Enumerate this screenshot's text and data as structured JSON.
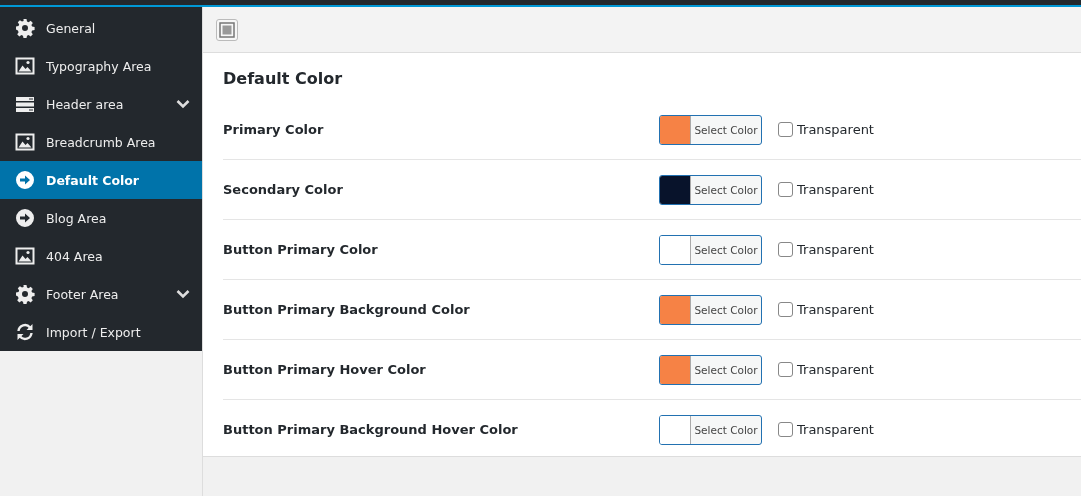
{
  "sidebar": {
    "items": [
      {
        "label": "General",
        "kind": "gear",
        "selected": false,
        "has_submenu": false
      },
      {
        "label": "Typography Area",
        "kind": "image",
        "selected": false,
        "has_submenu": false
      },
      {
        "label": "Header area",
        "kind": "list",
        "selected": false,
        "has_submenu": true
      },
      {
        "label": "Breadcrumb Area",
        "kind": "image",
        "selected": false,
        "has_submenu": false
      },
      {
        "label": "Default Color",
        "kind": "arrow",
        "selected": true,
        "has_submenu": false
      },
      {
        "label": "Blog Area",
        "kind": "arrow",
        "selected": false,
        "has_submenu": false
      },
      {
        "label": "404 Area",
        "kind": "image",
        "selected": false,
        "has_submenu": false
      },
      {
        "label": "Footer Area",
        "kind": "gear",
        "selected": false,
        "has_submenu": true
      },
      {
        "label": "Import / Export",
        "kind": "refresh",
        "selected": false,
        "has_submenu": false
      }
    ]
  },
  "section": {
    "title": "Default Color",
    "fields": [
      {
        "label": "Primary Color",
        "color": "#f68245",
        "button": "Select Color",
        "transparent_label": "Transparent",
        "checked": false
      },
      {
        "label": "Secondary Color",
        "color": "#08132b",
        "button": "Select Color",
        "transparent_label": "Transparent",
        "checked": false
      },
      {
        "label": "Button Primary Color",
        "color": "#ffffff",
        "button": "Select Color",
        "transparent_label": "Transparent",
        "checked": false
      },
      {
        "label": "Button Primary Background Color",
        "color": "#f68245",
        "button": "Select Color",
        "transparent_label": "Transparent",
        "checked": false
      },
      {
        "label": "Button Primary Hover Color",
        "color": "#f68245",
        "button": "Select Color",
        "transparent_label": "Transparent",
        "checked": false
      },
      {
        "label": "Button Primary Background Hover Color",
        "color": "#ffffff",
        "button": "Select Color",
        "transparent_label": "Transparent",
        "checked": false
      }
    ]
  }
}
